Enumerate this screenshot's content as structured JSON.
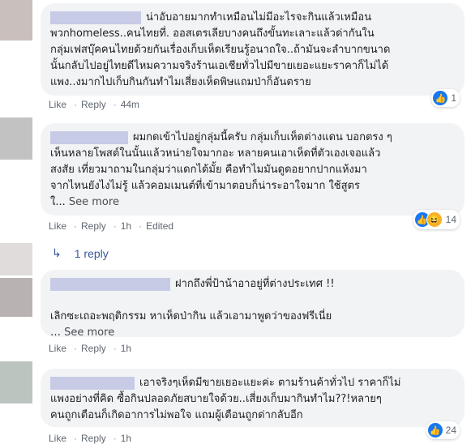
{
  "comments": [
    {
      "text": "น่าอับอายมากทำเหมือนไม่มีอะไรจะกินแล้วเหมือน\nพวกhomeless..คนไทยที่. ออสเตรเลียบางคนถึงขั้นทะเลาะแล้วด่ากันใน\nกลุ่มเฟสบุ๊คคนไทยด้วยกันเรื่องเก็บเห็ดเรียนรู้อนาถใจ..ถ้ามันจะลำบากขนาด\nนั้นกลับไปอยู่ไทยดีไหมความจริงร้านเอเชียทั่วไปมีขายเยอะแยะราคาก็ไม่ได้\nแพง..งมากไปเก็บกินกันทำไมเสี่ยงเห็ดพิษแถมป่าก็อันตราย",
      "like": "Like",
      "reply": "Reply",
      "time": "44m",
      "reaction_count": "1"
    },
    {
      "text": "ผมกดเข้าไปอยู่กลุ่มนี้ครับ กลุ่มเก็บเห็ดต่างแดน บอกตรง ๆ\nเห็นหลายโพสต์ในนั้นแล้วหน่ายใจมากอะ หลายคนเอาเห็ดที่ตัวเองเจอแล้ว\nสงสัย เที่ยวมาถามในกลุ่มว่าแดกได้มั้ย คือทำไมมันดูดอยากปากแห้งมา\nจากไหนยังไงไม่รู้ แล้วคอมเมนต์ที่เข้ามาตอบก็น่าระอาใจมาก ใช้สูตร\nใ...",
      "see_more": "See more",
      "like": "Like",
      "reply": "Reply",
      "time": "1h",
      "edited": "Edited",
      "reaction_count": "14"
    },
    {
      "reply_link": "1 reply"
    },
    {
      "text": "ฝากถึงพี่ป้าน้าอาอยู่ที่ต่างประเทศ !!\n\nเลิกซะเถอะพฤติกรรม หาเห็ดป่ากิน แล้วเอามาพูดว่าของฟรีเนี่ย\n…",
      "see_more": "See more",
      "like": "Like",
      "reply": "Reply",
      "time": "1h"
    },
    {
      "text": "เอาจริงๆเห็ดมีขายเยอะแยะค่ะ ตามร้านค้าทั่วไป ราคาก็ไม่\nแพงอย่างที่คิด ซื้อกินปลอดภัยสบายใจด้วย..เสี่ยงเก็บมากินทำไม??!หลายๆ\nคนถูกเตือนก็เกิดอาการไม่พอใจ แถมผู้เตือนถูกด่ากลับอีก",
      "like": "Like",
      "reply": "Reply",
      "time": "1h",
      "reaction_count": "24"
    }
  ]
}
